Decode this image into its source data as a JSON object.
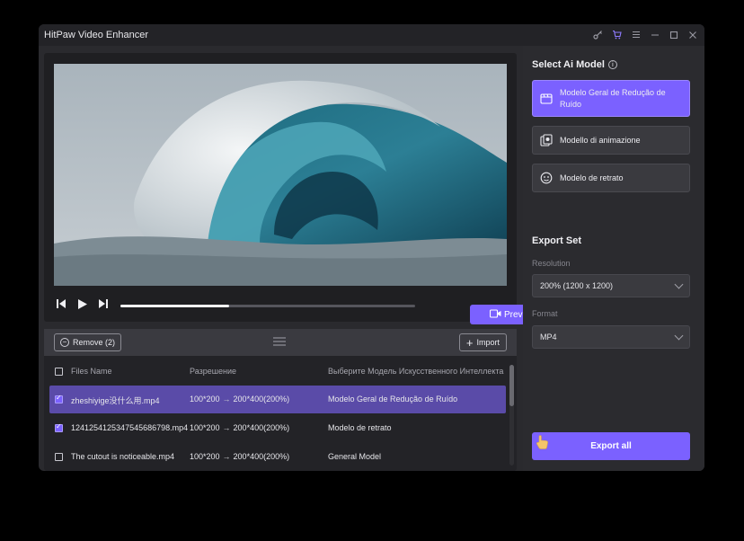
{
  "window": {
    "title": "HitPaw Video Enhancer",
    "icons": [
      "key-icon",
      "cart-icon",
      "menu-icon",
      "minimize-icon",
      "maximize-icon",
      "close-icon"
    ]
  },
  "player": {
    "progress_fraction": 0.37,
    "preview_label": "Prev"
  },
  "files": {
    "remove_label": "Remove (2)",
    "import_label": "Import",
    "columns": {
      "name": "Files Name",
      "resolution": "Разрешение",
      "model": "Выберите Модель Искусственного Интеллекта"
    },
    "rows": [
      {
        "name": "zheshiyige没什么用.mp4",
        "res_from": "100*200",
        "res_to": "200*400(200%)",
        "model": "Modelo Geral de Redução de Ruído",
        "checked": true,
        "selected": true
      },
      {
        "name": "1241254125347545686798.mp4",
        "res_from": "100*200",
        "res_to": "200*400(200%)",
        "model": "Modelo de retrato",
        "checked": true,
        "selected": false
      },
      {
        "name": "The cutout is noticeable.mp4",
        "res_from": "100*200",
        "res_to": "200*400(200%)",
        "model": "General Model",
        "checked": false,
        "selected": false
      }
    ]
  },
  "sidebar": {
    "select_title": "Select Ai Model",
    "models": [
      {
        "label": "Modelo Geral de Redução de Ruído",
        "icon": "film-icon",
        "active": true
      },
      {
        "label": "Modello di animazione",
        "icon": "animation-icon",
        "active": false
      },
      {
        "label": "Modelo de retrato",
        "icon": "portrait-icon",
        "active": false
      }
    ],
    "export_title": "Export Set",
    "resolution_label": "Resolution",
    "resolution_value": "200% (1200 x 1200)",
    "format_label": "Format",
    "format_value": "MP4",
    "export_all_label": "Export all"
  },
  "colors": {
    "accent": "#7b61ff",
    "panel": "#2a2a2e",
    "background": "#000000"
  }
}
